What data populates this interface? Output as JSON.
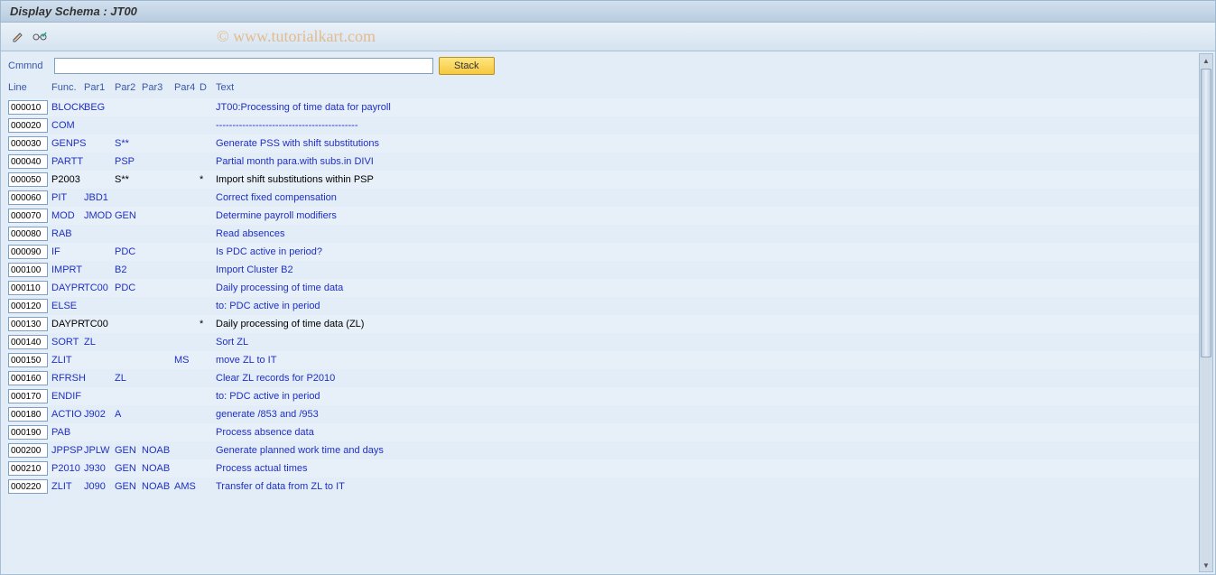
{
  "title": "Display Schema : JT00",
  "watermark": "© www.tutorialkart.com",
  "toolbar": {
    "icon1_name": "pencil-icon",
    "icon2_name": "glasses-check-icon"
  },
  "command": {
    "label": "Cmmnd",
    "value": "",
    "stack_label": "Stack"
  },
  "headers": {
    "line": "Line",
    "func": "Func.",
    "par1": "Par1",
    "par2": "Par2",
    "par3": "Par3",
    "par4": "Par4",
    "d": "D",
    "text": "Text"
  },
  "rows": [
    {
      "line": "000010",
      "func": "BLOCK",
      "par1": "BEG",
      "par2": "",
      "par3": "",
      "par4": "",
      "d": "",
      "text": "JT00:Processing of time data for payroll",
      "black": false
    },
    {
      "line": "000020",
      "func": "COM",
      "par1": "",
      "par2": "",
      "par3": "",
      "par4": "",
      "d": "",
      "text": "-------------------------------------------",
      "black": false
    },
    {
      "line": "000030",
      "func": "GENPS",
      "par1": "",
      "par2": "S**",
      "par3": "",
      "par4": "",
      "d": "",
      "text": "Generate PSS with shift substitutions",
      "black": false
    },
    {
      "line": "000040",
      "func": "PARTT",
      "par1": "",
      "par2": "PSP",
      "par3": "",
      "par4": "",
      "d": "",
      "text": "Partial month para.with subs.in DIVI",
      "black": false
    },
    {
      "line": "000050",
      "func": "P2003",
      "par1": "",
      "par2": "S**",
      "par3": "",
      "par4": "",
      "d": "*",
      "text": "Import shift substitutions within PSP",
      "black": true
    },
    {
      "line": "000060",
      "func": "PIT",
      "par1": "JBD1",
      "par2": "",
      "par3": "",
      "par4": "",
      "d": "",
      "text": "Correct fixed compensation",
      "black": false
    },
    {
      "line": "000070",
      "func": "MOD",
      "par1": "JMOD",
      "par2": "GEN",
      "par3": "",
      "par4": "",
      "d": "",
      "text": "Determine payroll modifiers",
      "black": false
    },
    {
      "line": "000080",
      "func": "RAB",
      "par1": "",
      "par2": "",
      "par3": "",
      "par4": "",
      "d": "",
      "text": "Read absences",
      "black": false
    },
    {
      "line": "000090",
      "func": "IF",
      "par1": "",
      "par2": "PDC",
      "par3": "",
      "par4": "",
      "d": "",
      "text": "Is PDC active in period?",
      "black": false
    },
    {
      "line": "000100",
      "func": "IMPRT",
      "par1": "",
      "par2": "B2",
      "par3": "",
      "par4": "",
      "d": "",
      "text": "Import Cluster B2",
      "black": false
    },
    {
      "line": "000110",
      "func": "DAYPR",
      "par1": "TC00",
      "par2": "PDC",
      "par3": "",
      "par4": "",
      "d": "",
      "text": "Daily processing of time data",
      "black": false
    },
    {
      "line": "000120",
      "func": "ELSE",
      "par1": "",
      "par2": "",
      "par3": "",
      "par4": "",
      "d": "",
      "text": "to: PDC active in period",
      "black": false
    },
    {
      "line": "000130",
      "func": "DAYPR",
      "par1": "TC00",
      "par2": "",
      "par3": "",
      "par4": "",
      "d": "*",
      "text": "Daily processing of time data (ZL)",
      "black": true
    },
    {
      "line": "000140",
      "func": "SORT",
      "par1": "ZL",
      "par2": "",
      "par3": "",
      "par4": "",
      "d": "",
      "text": "Sort ZL",
      "black": false
    },
    {
      "line": "000150",
      "func": "ZLIT",
      "par1": "",
      "par2": "",
      "par3": "",
      "par4": "MS",
      "d": "",
      "text": "move ZL to IT",
      "black": false
    },
    {
      "line": "000160",
      "func": "RFRSH",
      "par1": "",
      "par2": "ZL",
      "par3": "",
      "par4": "",
      "d": "",
      "text": "Clear ZL records for P2010",
      "black": false
    },
    {
      "line": "000170",
      "func": "ENDIF",
      "par1": "",
      "par2": "",
      "par3": "",
      "par4": "",
      "d": "",
      "text": "to: PDC active in period",
      "black": false
    },
    {
      "line": "000180",
      "func": "ACTIO",
      "par1": "J902",
      "par2": "A",
      "par3": "",
      "par4": "",
      "d": "",
      "text": "generate /853 and /953",
      "black": false
    },
    {
      "line": "000190",
      "func": "PAB",
      "par1": "",
      "par2": "",
      "par3": "",
      "par4": "",
      "d": "",
      "text": "Process absence data",
      "black": false
    },
    {
      "line": "000200",
      "func": "JPPSP",
      "par1": "JPLW",
      "par2": "GEN",
      "par3": "NOAB",
      "par4": "",
      "d": "",
      "text": "Generate planned work time and days",
      "black": false
    },
    {
      "line": "000210",
      "func": "P2010",
      "par1": "J930",
      "par2": "GEN",
      "par3": "NOAB",
      "par4": "",
      "d": "",
      "text": "Process actual times",
      "black": false
    },
    {
      "line": "000220",
      "func": "ZLIT",
      "par1": "J090",
      "par2": "GEN",
      "par3": "NOAB",
      "par4": "AMS",
      "d": "",
      "text": "Transfer of data from ZL to IT",
      "black": false
    }
  ]
}
